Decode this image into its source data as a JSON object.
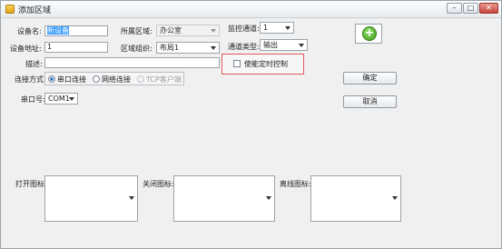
{
  "window": {
    "title": "添加区域",
    "minimize": "–",
    "maximize": "□",
    "close": "✕"
  },
  "form": {
    "device_name_label": "设备名:",
    "device_name_value": "新设备",
    "device_addr_label": "设备地址:",
    "device_addr_value": "1",
    "area_label": "所属区域:",
    "area_value": "办公室",
    "area_group_label": "区域组织:",
    "area_group_value": "布局1",
    "monitor_channel_label": "监控通道:",
    "monitor_channel_value": "1",
    "channel_type_label": "通道类型:",
    "channel_type_value": "输出",
    "desc_label": "描述:",
    "desc_value": "",
    "timer_checkbox_label": "使能定时控制",
    "conn_label": "连接方式:",
    "conn_options": [
      "串口连接",
      "网络连接",
      "TCP客户端"
    ],
    "port_label": "串口号:",
    "port_value": "COM1",
    "open_icon_label": "打开图标:",
    "close_icon_label": "关闭图标:",
    "offline_icon_label": "离线图标:"
  },
  "buttons": {
    "ok": "确定",
    "cancel": "取消",
    "add": "+"
  }
}
